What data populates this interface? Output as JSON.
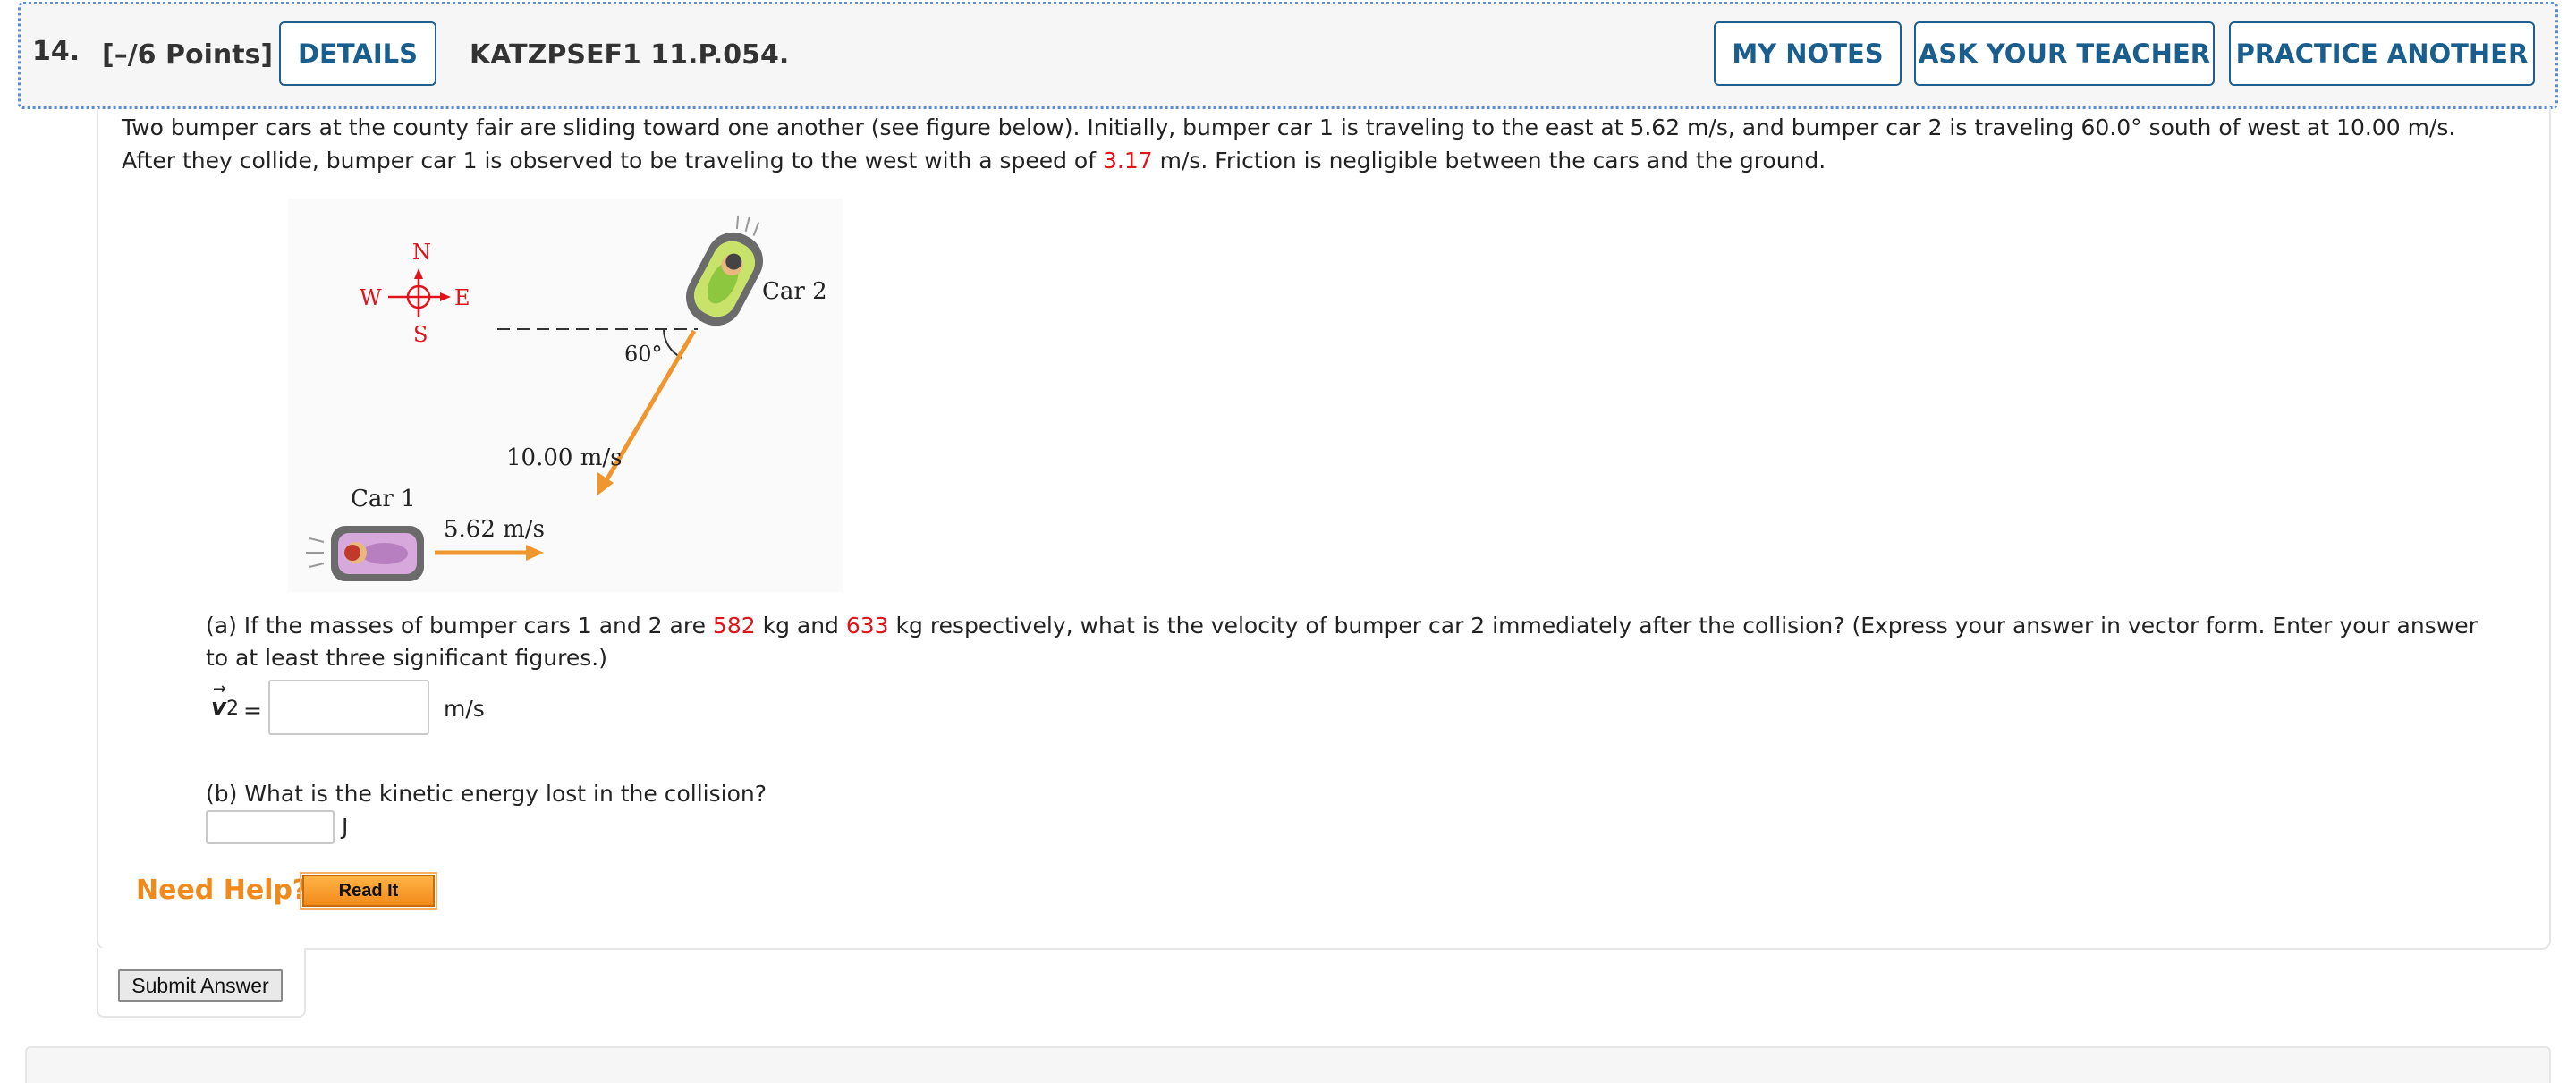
{
  "question": {
    "number": "14.",
    "points": "[–/6 Points]",
    "details_label": "DETAILS",
    "code": "KATZPSEF1 11.P.054.",
    "my_notes_label": "MY NOTES",
    "ask_teacher_label": "ASK YOUR TEACHER",
    "practice_label": "PRACTICE ANOTHER"
  },
  "prompt": {
    "part1": "Two bumper cars at the county fair are sliding toward one another (see figure below). Initially, bumper car 1 is traveling to the east at 5.62 m/s, and bumper car 2 is traveling 60.0° south of west at 10.00 m/s. After they collide, bumper car 1 is observed to be traveling to the west with a speed of ",
    "speed_after": "3.17",
    "part2": " m/s. Friction is negligible between the cars and the ground."
  },
  "figure": {
    "compass_n": "N",
    "compass_s": "S",
    "compass_e": "E",
    "compass_w": "W",
    "car1_label": "Car 1",
    "car2_label": "Car 2",
    "car1_speed": "5.62 m/s",
    "car2_speed": "10.00 m/s",
    "angle": "60°",
    "colors": {
      "arrow": "#f0962e",
      "compass": "#e0131a"
    }
  },
  "part_a": {
    "text1": "(a) If the masses of bumper cars 1 and 2 are ",
    "mass1": "582",
    "text2": " kg and ",
    "mass2": "633",
    "text3": " kg respectively, what is the velocity of bumper car 2 immediately after the collision? (Express your answer in vector form. Enter your answer to at least three significant figures.)",
    "vector_label": "v",
    "vector_sub": "2",
    "vector_arrow": "→",
    "equals": "=",
    "value": "",
    "unit": "m/s"
  },
  "part_b": {
    "text": "(b) What is the kinetic energy lost in the collision?",
    "value": "",
    "unit": "J"
  },
  "help": {
    "need_help": "Need Help?",
    "read_it": "Read It"
  },
  "submit_label": "Submit Answer"
}
